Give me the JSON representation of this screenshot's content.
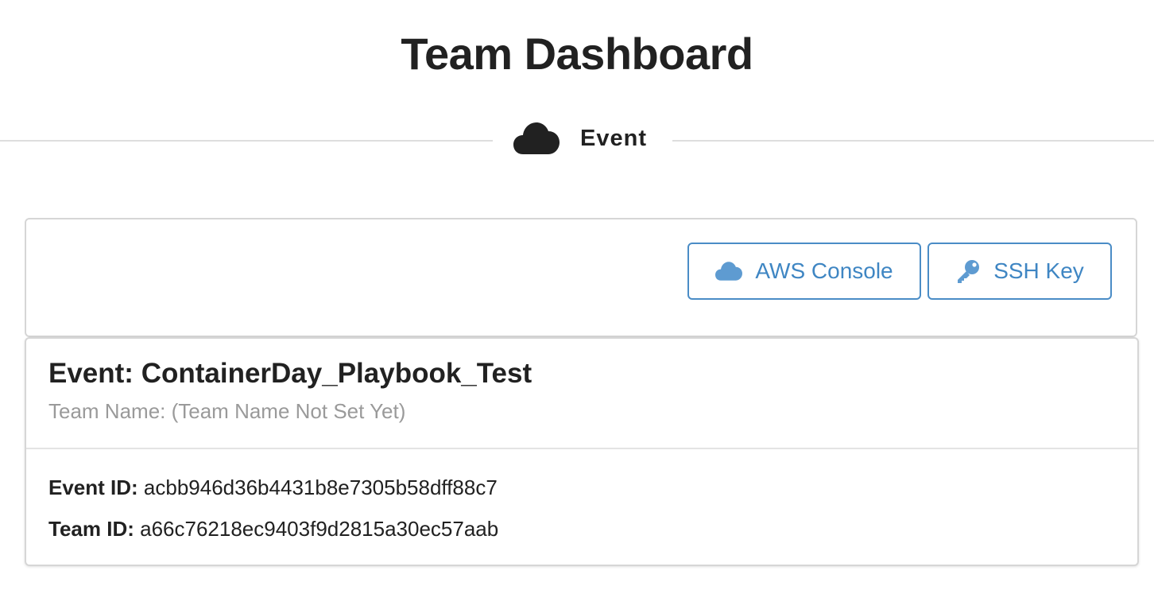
{
  "header": {
    "title": "Team Dashboard"
  },
  "section": {
    "label": "Event",
    "icon": "cloud-icon"
  },
  "toolbar": {
    "aws_console_label": "AWS Console",
    "aws_console_icon": "cloud-icon",
    "ssh_key_label": "SSH Key",
    "ssh_key_icon": "key-icon",
    "accent_color": "#4a8cc6"
  },
  "event_card": {
    "title": "Event: ContainerDay_Playbook_Test",
    "team_name": "Team Name: (Team Name Not Set Yet)",
    "event_id_key": "Event ID:",
    "event_id_value": "acbb946d36b4431b8e7305b58dff88c7",
    "team_id_key": "Team ID:",
    "team_id_value": "a66c76218ec9403f9d2815a30ec57aab"
  }
}
